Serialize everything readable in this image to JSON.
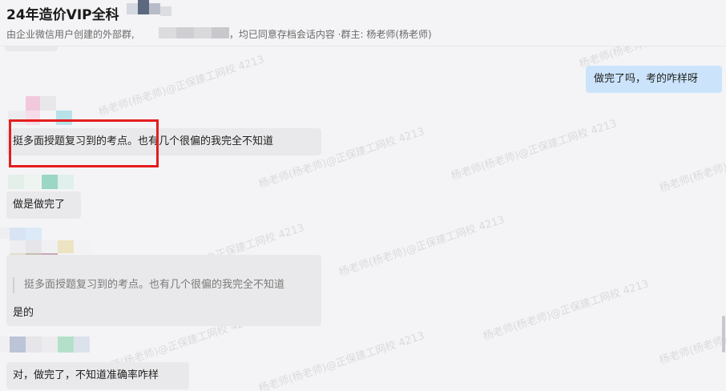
{
  "header": {
    "title": "24年造价VIP全科",
    "subtitle_before": "由企业微信用户创建的外部群,",
    "subtitle_after": "系人，均已同意存档会话内容 ·群主: 杨老师(杨老师)"
  },
  "messages": [
    {
      "id": "m1",
      "side": "right",
      "text": "做完了吗，考的咋样呀"
    },
    {
      "id": "m2",
      "side": "left",
      "text_highlighted": "挺多面授题复习到的考点。",
      "text_rest": "也有几个很偏的我完全不知道"
    },
    {
      "id": "m3",
      "side": "left",
      "text": "做是做完了"
    },
    {
      "id": "m4",
      "side": "left",
      "quote": "挺多面授题复习到的考点。也有几个很偏的我完全不知道",
      "text": "是的"
    },
    {
      "id": "m5",
      "side": "left",
      "text": "对，做完了，不知道准确率咋样"
    }
  ],
  "watermark_text": "杨老师(杨老师)@正保建工网校 4213",
  "colors": {
    "background": "#f4f4f6",
    "bubble_left": "#e9e9eb",
    "bubble_right": "#cce4fb",
    "highlight": "#e41d1d"
  }
}
